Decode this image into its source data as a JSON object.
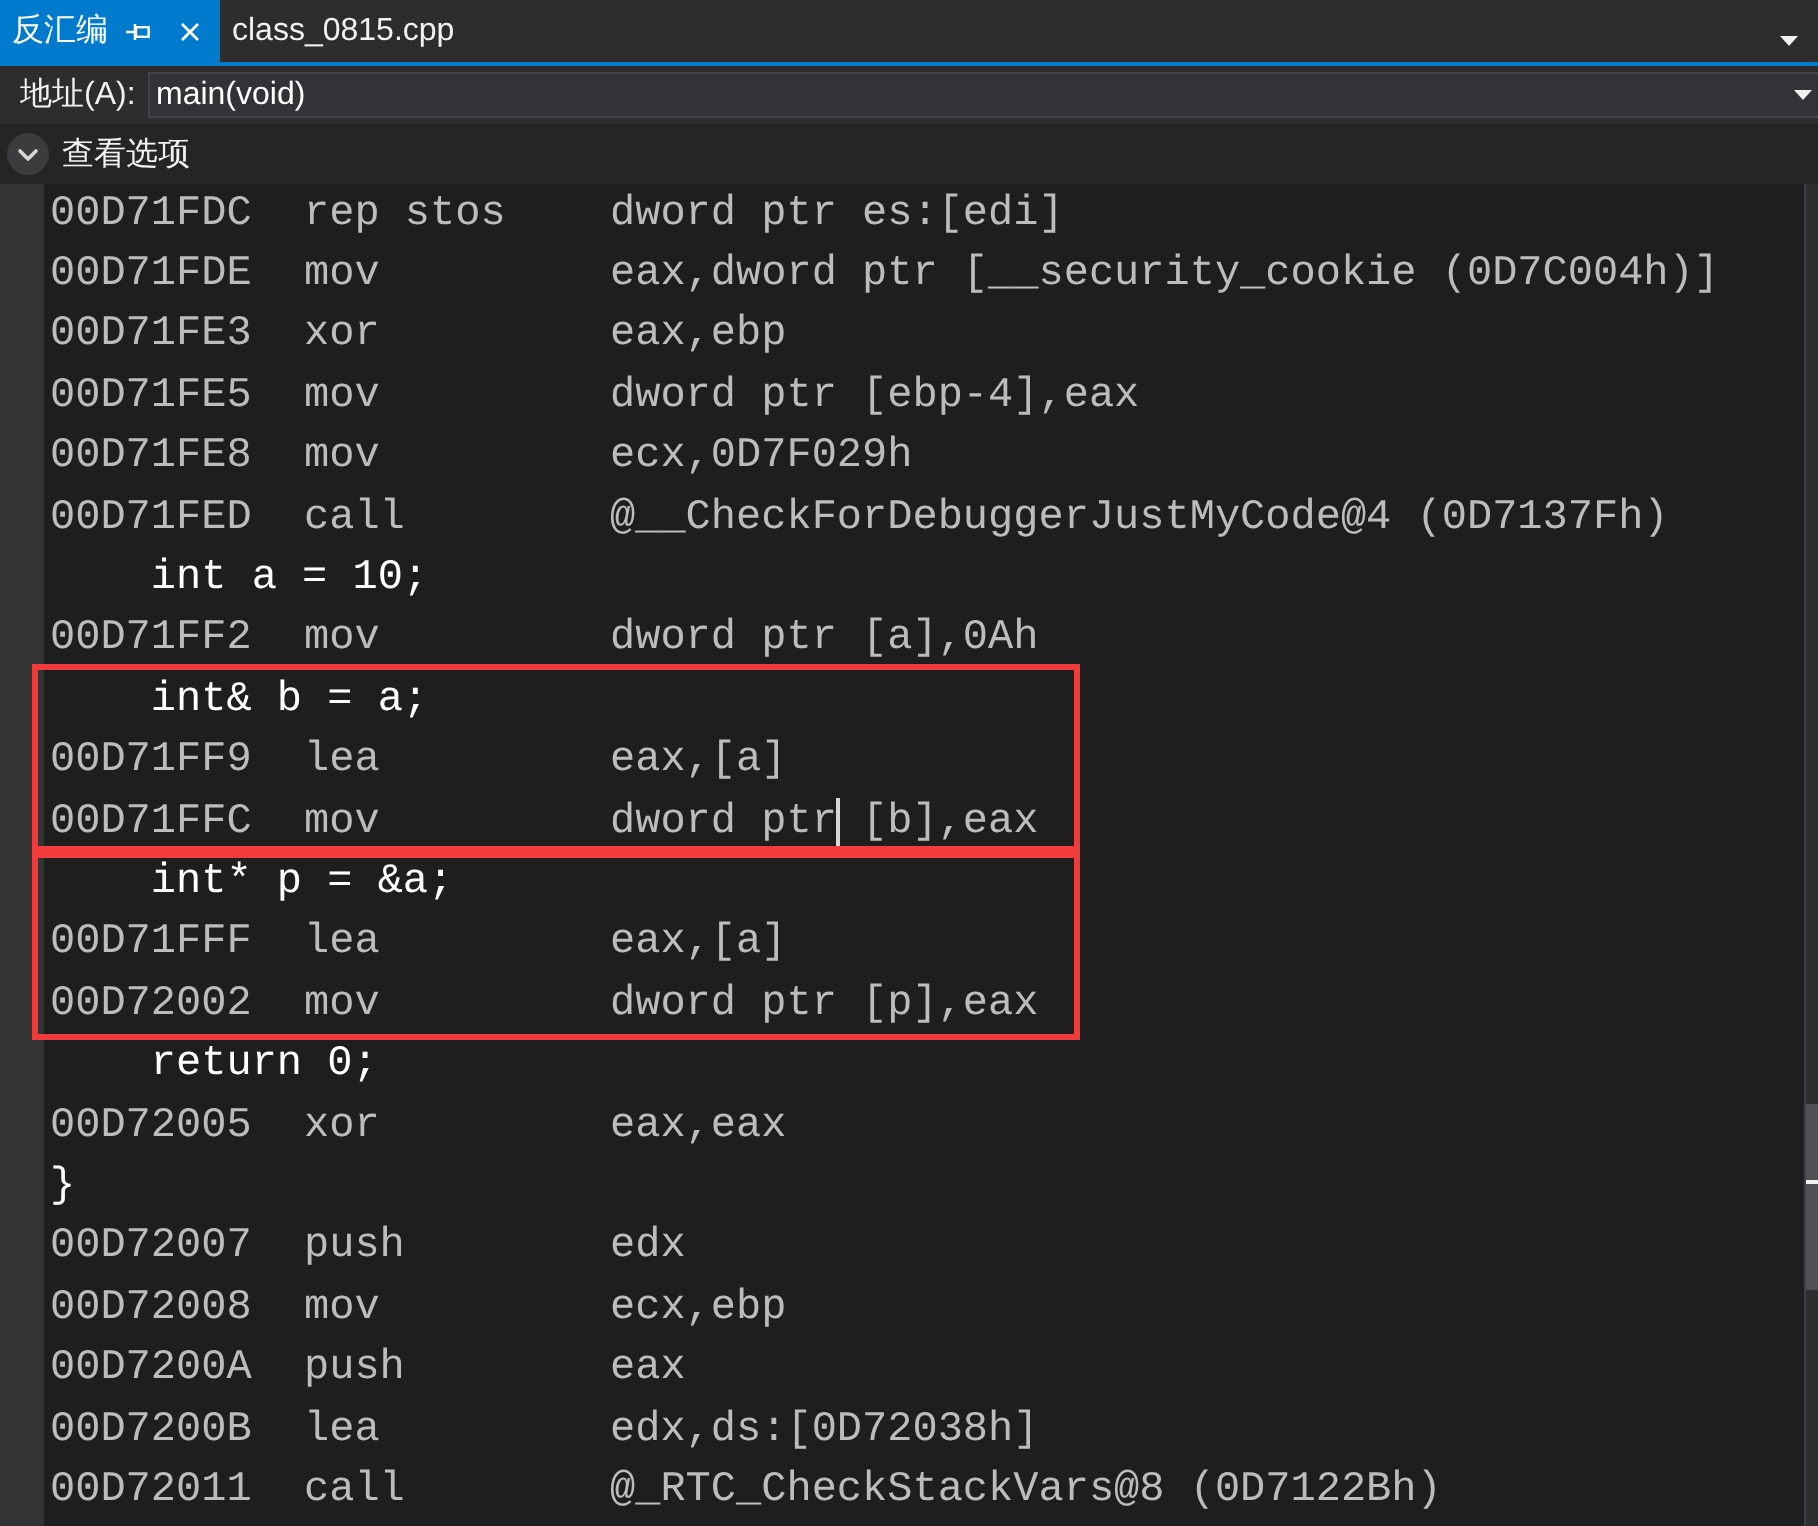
{
  "tab_strip": {
    "tabs": [
      {
        "label": "反汇编",
        "selected": true
      },
      {
        "label": "class_0815.cpp",
        "selected": false
      }
    ]
  },
  "address_bar": {
    "label": "地址(A):",
    "value": "main(void)"
  },
  "view_options": {
    "label": "查看选项",
    "expanded": false
  },
  "disassembly": {
    "lines": [
      {
        "kind": "asm",
        "address": "00D71FDC",
        "mnemonic": "rep stos",
        "operands": "dword ptr es:[edi]",
        "cursor": false
      },
      {
        "kind": "asm",
        "address": "00D71FDE",
        "mnemonic": "mov",
        "operands": "eax,dword ptr [__security_cookie (0D7C004h)]",
        "cursor": false
      },
      {
        "kind": "asm",
        "address": "00D71FE3",
        "mnemonic": "xor",
        "operands": "eax,ebp",
        "cursor": false
      },
      {
        "kind": "asm",
        "address": "00D71FE5",
        "mnemonic": "mov",
        "operands": "dword ptr [ebp-4],eax",
        "cursor": false
      },
      {
        "kind": "asm",
        "address": "00D71FE8",
        "mnemonic": "mov",
        "operands": "ecx,0D7F029h",
        "cursor": false
      },
      {
        "kind": "asm",
        "address": "00D71FED",
        "mnemonic": "call",
        "operands": "@__CheckForDebuggerJustMyCode@4 (0D7137Fh)",
        "cursor": false
      },
      {
        "kind": "source",
        "text": "int a = 10;",
        "indented": true,
        "cursor": false
      },
      {
        "kind": "asm",
        "address": "00D71FF2",
        "mnemonic": "mov",
        "operands": "dword ptr [a],0Ah",
        "cursor": false
      },
      {
        "kind": "highlight",
        "lines": [
          {
            "kind": "source",
            "text": "int& b = a;",
            "indented": true,
            "cursor": false
          },
          {
            "kind": "asm",
            "address": "00D71FF9",
            "mnemonic": "lea",
            "operands": "eax,[a]",
            "cursor": false
          },
          {
            "kind": "asm",
            "address": "00D71FFC",
            "mnemonic": "mov",
            "operands": "dword ptr [b],eax",
            "cursor": true
          }
        ]
      },
      {
        "kind": "highlight",
        "lines": [
          {
            "kind": "source",
            "text": "int* p = &a;",
            "indented": true,
            "cursor": false
          },
          {
            "kind": "asm",
            "address": "00D71FFF",
            "mnemonic": "lea",
            "operands": "eax,[a]",
            "cursor": false
          },
          {
            "kind": "asm",
            "address": "00D72002",
            "mnemonic": "mov",
            "operands": "dword ptr [p],eax",
            "cursor": false
          }
        ]
      },
      {
        "kind": "source",
        "text": "return 0;",
        "indented": true,
        "cursor": false
      },
      {
        "kind": "asm",
        "address": "00D72005",
        "mnemonic": "xor",
        "operands": "eax,eax",
        "cursor": false
      },
      {
        "kind": "source",
        "text": "}",
        "indented": false,
        "cursor": false
      },
      {
        "kind": "asm",
        "address": "00D72007",
        "mnemonic": "push",
        "operands": "edx",
        "cursor": false
      },
      {
        "kind": "asm",
        "address": "00D72008",
        "mnemonic": "mov",
        "operands": "ecx,ebp",
        "cursor": false
      },
      {
        "kind": "asm",
        "address": "00D7200A",
        "mnemonic": "push",
        "operands": "eax",
        "cursor": false
      },
      {
        "kind": "asm",
        "address": "00D7200B",
        "mnemonic": "lea",
        "operands": "edx,ds:[0D72038h]",
        "cursor": false
      },
      {
        "kind": "asm",
        "address": "00D72011",
        "mnemonic": "call",
        "operands": "@_RTC_CheckStackVars@8 (0D7122Bh)",
        "cursor": false
      }
    ]
  }
}
